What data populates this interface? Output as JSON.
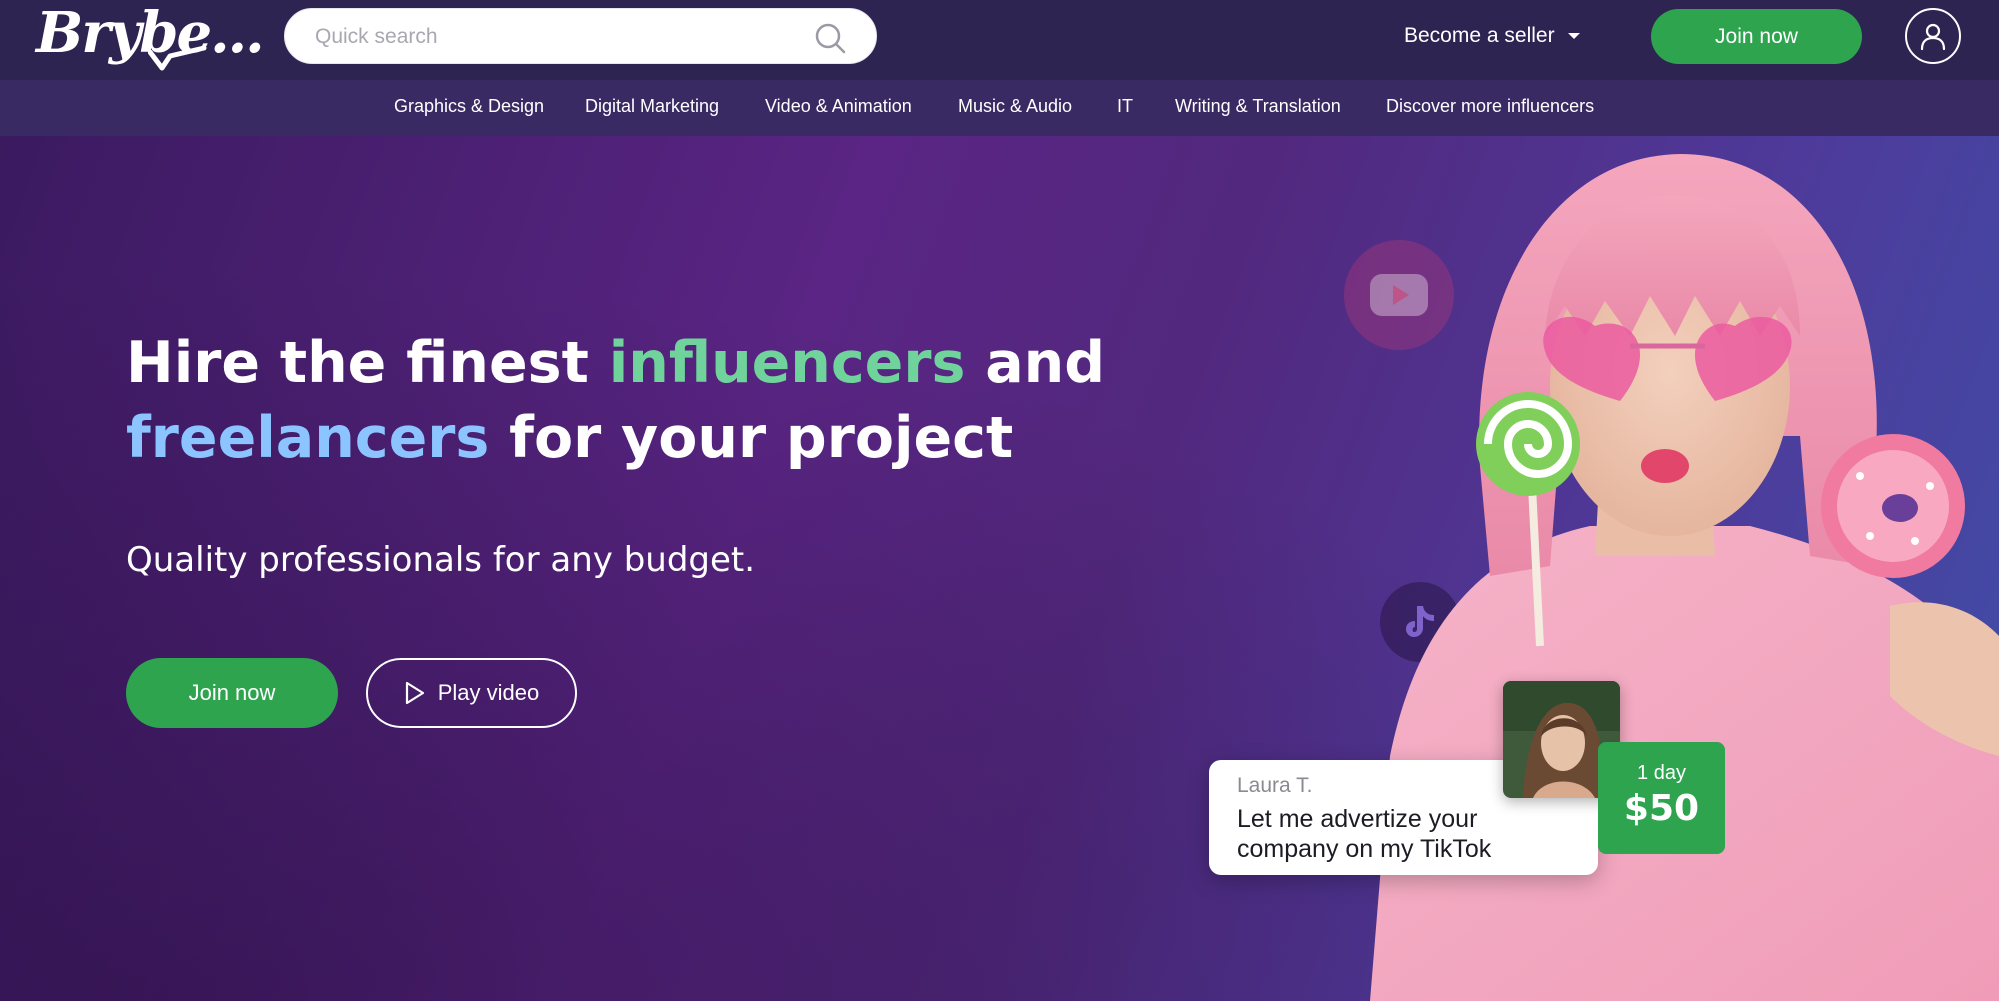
{
  "header": {
    "logo_text": "Brybe...",
    "search": {
      "placeholder": "Quick search",
      "value": ""
    },
    "seller_label": "Become a seller",
    "join_label": "Join now"
  },
  "categories": [
    "Graphics & Design",
    "Digital Marketing",
    "Video & Animation",
    "Music & Audio",
    "IT",
    "Writing & Translation",
    "Discover more influencers"
  ],
  "hero": {
    "headline": {
      "part1": "Hire the finest ",
      "highlight1": "influencers",
      "part2": " and",
      "highlight2": "freelancers",
      "part3": " for your project"
    },
    "subline": "Quality professionals for any budget.",
    "join_label": "Join now",
    "play_label": "Play video"
  },
  "offer": {
    "name": "Laura T.",
    "message": "Let me advertize your company on my TikTok",
    "duration": "1 day",
    "price": "$50"
  },
  "colors": {
    "header_bg": "#2e2452",
    "nav_bg": "#3a2a63",
    "accent_green": "#2ea44f",
    "highlight_green": "#6fd39b",
    "highlight_blue": "#8cc4ff"
  },
  "icons": {
    "search": "search-icon",
    "seller_dropdown": "caret-down-icon",
    "account": "user-icon",
    "play": "play-icon",
    "youtube": "youtube-icon",
    "tiktok": "tiktok-icon"
  }
}
